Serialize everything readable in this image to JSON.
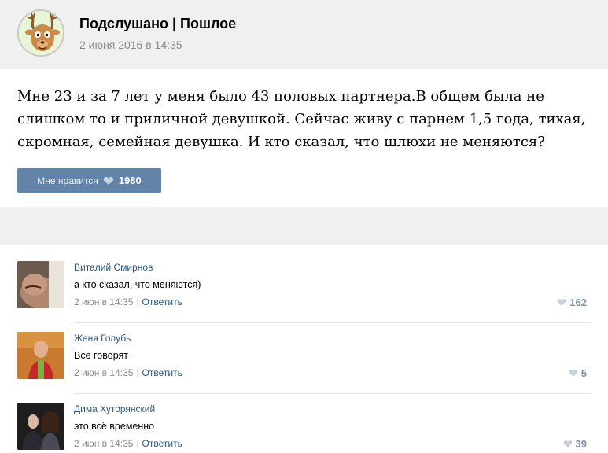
{
  "post": {
    "group_name": "Подслушано | Пошлое",
    "date": "2 июня 2016 в 14:35",
    "text": "Мне 23 и за 7 лет у меня было 43 половых партнера.В общем была не слишком то и приличной девушкой. Сейчас живу с парнем 1,5 года, тихая, скромная, семейная девушка. И кто сказал, что шлюхи не меняются?",
    "like_label": "Мне нравится",
    "like_count": "1980"
  },
  "comments": [
    {
      "author": "Виталий Смирнов",
      "text": "а кто сказал, что меняются)",
      "date": "2 июн в 14:35",
      "reply": "Ответить",
      "likes": "162"
    },
    {
      "author": "Женя Голубь",
      "text": "Все говорят",
      "date": "2 июн в 14:35",
      "reply": "Ответить",
      "likes": "5"
    },
    {
      "author": "Дима Хуторянский",
      "text": "это всё временно",
      "date": "2 июн в 14:35",
      "reply": "Ответить",
      "likes": "39"
    }
  ],
  "colors": {
    "like_button": "#6383a8",
    "link": "#2b587a",
    "band": "#f0f0f0"
  },
  "icons": {
    "like": "heart-icon",
    "group_avatar": "deer-mascot"
  }
}
